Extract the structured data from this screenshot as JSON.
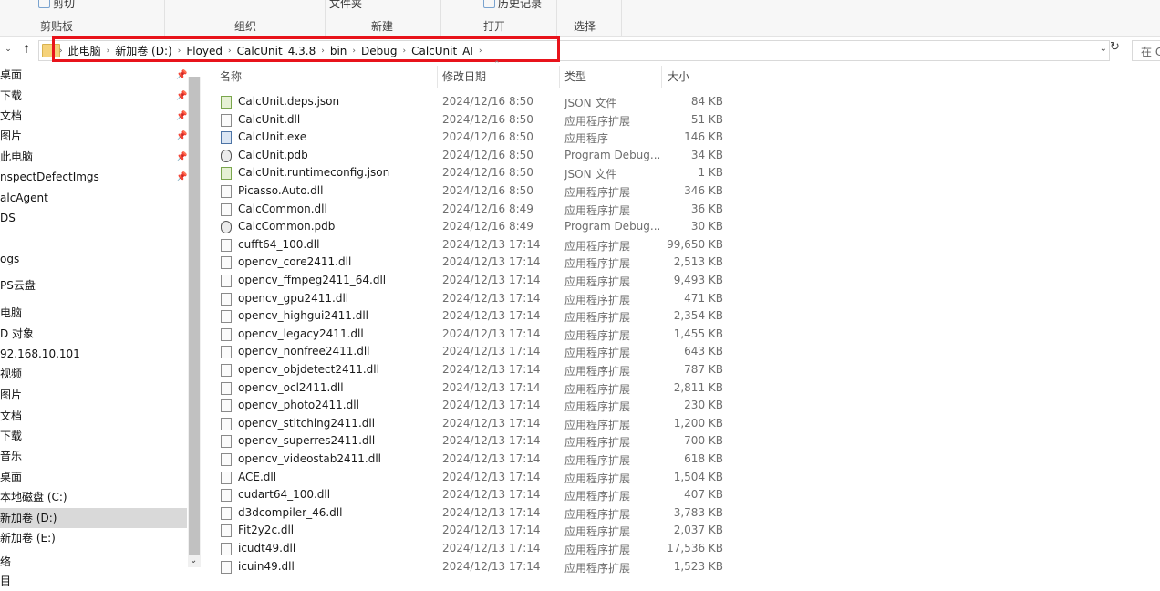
{
  "ribbon": {
    "clipboard": {
      "top_item": "剪切",
      "label": "剪贴板"
    },
    "organize": {
      "label": "组织"
    },
    "new": {
      "top_item": "文件夹",
      "label": "新建"
    },
    "open": {
      "top_item": "历史记录",
      "label": "打开"
    },
    "select": {
      "label": "选择"
    }
  },
  "address_bar": {
    "breadcrumbs": [
      "此电脑",
      "新加卷 (D:)",
      "Floyed",
      "CalcUnit_4.3.8",
      "bin",
      "Debug",
      "CalcUnit_AI"
    ],
    "search_placeholder": "在 C"
  },
  "nav_pane": {
    "items": [
      {
        "label": "桌面",
        "pinned": true
      },
      {
        "label": "下载",
        "pinned": true
      },
      {
        "label": "文档",
        "pinned": true
      },
      {
        "label": "图片",
        "pinned": true
      },
      {
        "label": "此电脑",
        "pinned": true
      },
      {
        "label": "nspectDefectImgs",
        "pinned": true
      },
      {
        "label": "alcAgent",
        "pinned": false
      },
      {
        "label": "DS",
        "pinned": false
      },
      {
        "label": "",
        "pinned": false
      },
      {
        "label": "ogs",
        "pinned": false
      },
      {
        "label": "PS云盘",
        "pinned": false
      },
      {
        "label": "电脑",
        "pinned": false
      },
      {
        "label": "D 对象",
        "pinned": false
      },
      {
        "label": "92.168.10.101",
        "pinned": false
      },
      {
        "label": "视频",
        "pinned": false
      },
      {
        "label": "图片",
        "pinned": false
      },
      {
        "label": "文档",
        "pinned": false
      },
      {
        "label": "下载",
        "pinned": false
      },
      {
        "label": "音乐",
        "pinned": false
      },
      {
        "label": "桌面",
        "pinned": false
      },
      {
        "label": "本地磁盘 (C:)",
        "pinned": false
      },
      {
        "label": "新加卷 (D:)",
        "pinned": false,
        "selected": true
      },
      {
        "label": "新加卷 (E:)",
        "pinned": false
      },
      {
        "label": "络",
        "pinned": false
      },
      {
        "label": "目",
        "pinned": false
      }
    ]
  },
  "columns": {
    "name": "名称",
    "date": "修改日期",
    "type": "类型",
    "size": "大小"
  },
  "files": [
    {
      "name": "CalcUnit.deps.json",
      "date": "2024/12/16 8:50",
      "type": "JSON 文件",
      "size": "84 KB",
      "icon": "json-file-icon"
    },
    {
      "name": "CalcUnit.dll",
      "date": "2024/12/16 8:50",
      "type": "应用程序扩展",
      "size": "51 KB",
      "icon": "dll-file-icon"
    },
    {
      "name": "CalcUnit.exe",
      "date": "2024/12/16 8:50",
      "type": "应用程序",
      "size": "146 KB",
      "icon": "exe-file-icon"
    },
    {
      "name": "CalcUnit.pdb",
      "date": "2024/12/16 8:50",
      "type": "Program Debug...",
      "size": "34 KB",
      "icon": "pdb-file-icon"
    },
    {
      "name": "CalcUnit.runtimeconfig.json",
      "date": "2024/12/16 8:50",
      "type": "JSON 文件",
      "size": "1 KB",
      "icon": "json-file-icon"
    },
    {
      "name": "Picasso.Auto.dll",
      "date": "2024/12/16 8:50",
      "type": "应用程序扩展",
      "size": "346 KB",
      "icon": "dll-file-icon"
    },
    {
      "name": "CalcCommon.dll",
      "date": "2024/12/16 8:49",
      "type": "应用程序扩展",
      "size": "36 KB",
      "icon": "dll-file-icon"
    },
    {
      "name": "CalcCommon.pdb",
      "date": "2024/12/16 8:49",
      "type": "Program Debug...",
      "size": "30 KB",
      "icon": "pdb-file-icon"
    },
    {
      "name": "cufft64_100.dll",
      "date": "2024/12/13 17:14",
      "type": "应用程序扩展",
      "size": "99,650 KB",
      "icon": "dll-file-icon"
    },
    {
      "name": "opencv_core2411.dll",
      "date": "2024/12/13 17:14",
      "type": "应用程序扩展",
      "size": "2,513 KB",
      "icon": "dll-file-icon"
    },
    {
      "name": "opencv_ffmpeg2411_64.dll",
      "date": "2024/12/13 17:14",
      "type": "应用程序扩展",
      "size": "9,493 KB",
      "icon": "dll-file-icon"
    },
    {
      "name": "opencv_gpu2411.dll",
      "date": "2024/12/13 17:14",
      "type": "应用程序扩展",
      "size": "471 KB",
      "icon": "dll-file-icon"
    },
    {
      "name": "opencv_highgui2411.dll",
      "date": "2024/12/13 17:14",
      "type": "应用程序扩展",
      "size": "2,354 KB",
      "icon": "dll-file-icon"
    },
    {
      "name": "opencv_legacy2411.dll",
      "date": "2024/12/13 17:14",
      "type": "应用程序扩展",
      "size": "1,455 KB",
      "icon": "dll-file-icon"
    },
    {
      "name": "opencv_nonfree2411.dll",
      "date": "2024/12/13 17:14",
      "type": "应用程序扩展",
      "size": "643 KB",
      "icon": "dll-file-icon"
    },
    {
      "name": "opencv_objdetect2411.dll",
      "date": "2024/12/13 17:14",
      "type": "应用程序扩展",
      "size": "787 KB",
      "icon": "dll-file-icon"
    },
    {
      "name": "opencv_ocl2411.dll",
      "date": "2024/12/13 17:14",
      "type": "应用程序扩展",
      "size": "2,811 KB",
      "icon": "dll-file-icon"
    },
    {
      "name": "opencv_photo2411.dll",
      "date": "2024/12/13 17:14",
      "type": "应用程序扩展",
      "size": "230 KB",
      "icon": "dll-file-icon"
    },
    {
      "name": "opencv_stitching2411.dll",
      "date": "2024/12/13 17:14",
      "type": "应用程序扩展",
      "size": "1,200 KB",
      "icon": "dll-file-icon"
    },
    {
      "name": "opencv_superres2411.dll",
      "date": "2024/12/13 17:14",
      "type": "应用程序扩展",
      "size": "700 KB",
      "icon": "dll-file-icon"
    },
    {
      "name": "opencv_videostab2411.dll",
      "date": "2024/12/13 17:14",
      "type": "应用程序扩展",
      "size": "618 KB",
      "icon": "dll-file-icon"
    },
    {
      "name": "ACE.dll",
      "date": "2024/12/13 17:14",
      "type": "应用程序扩展",
      "size": "1,504 KB",
      "icon": "dll-file-icon"
    },
    {
      "name": "cudart64_100.dll",
      "date": "2024/12/13 17:14",
      "type": "应用程序扩展",
      "size": "407 KB",
      "icon": "dll-file-icon"
    },
    {
      "name": "d3dcompiler_46.dll",
      "date": "2024/12/13 17:14",
      "type": "应用程序扩展",
      "size": "3,783 KB",
      "icon": "dll-file-icon"
    },
    {
      "name": "Fit2y2c.dll",
      "date": "2024/12/13 17:14",
      "type": "应用程序扩展",
      "size": "2,037 KB",
      "icon": "dll-file-icon"
    },
    {
      "name": "icudt49.dll",
      "date": "2024/12/13 17:14",
      "type": "应用程序扩展",
      "size": "17,536 KB",
      "icon": "dll-file-icon"
    },
    {
      "name": "icuin49.dll",
      "date": "2024/12/13 17:14",
      "type": "应用程序扩展",
      "size": "1,523 KB",
      "icon": "dll-file-icon"
    }
  ],
  "colors": {
    "highlight_box": "#e8131b",
    "selected_nav": "#d9d9d9",
    "secondary_text": "#6d6d6d"
  }
}
